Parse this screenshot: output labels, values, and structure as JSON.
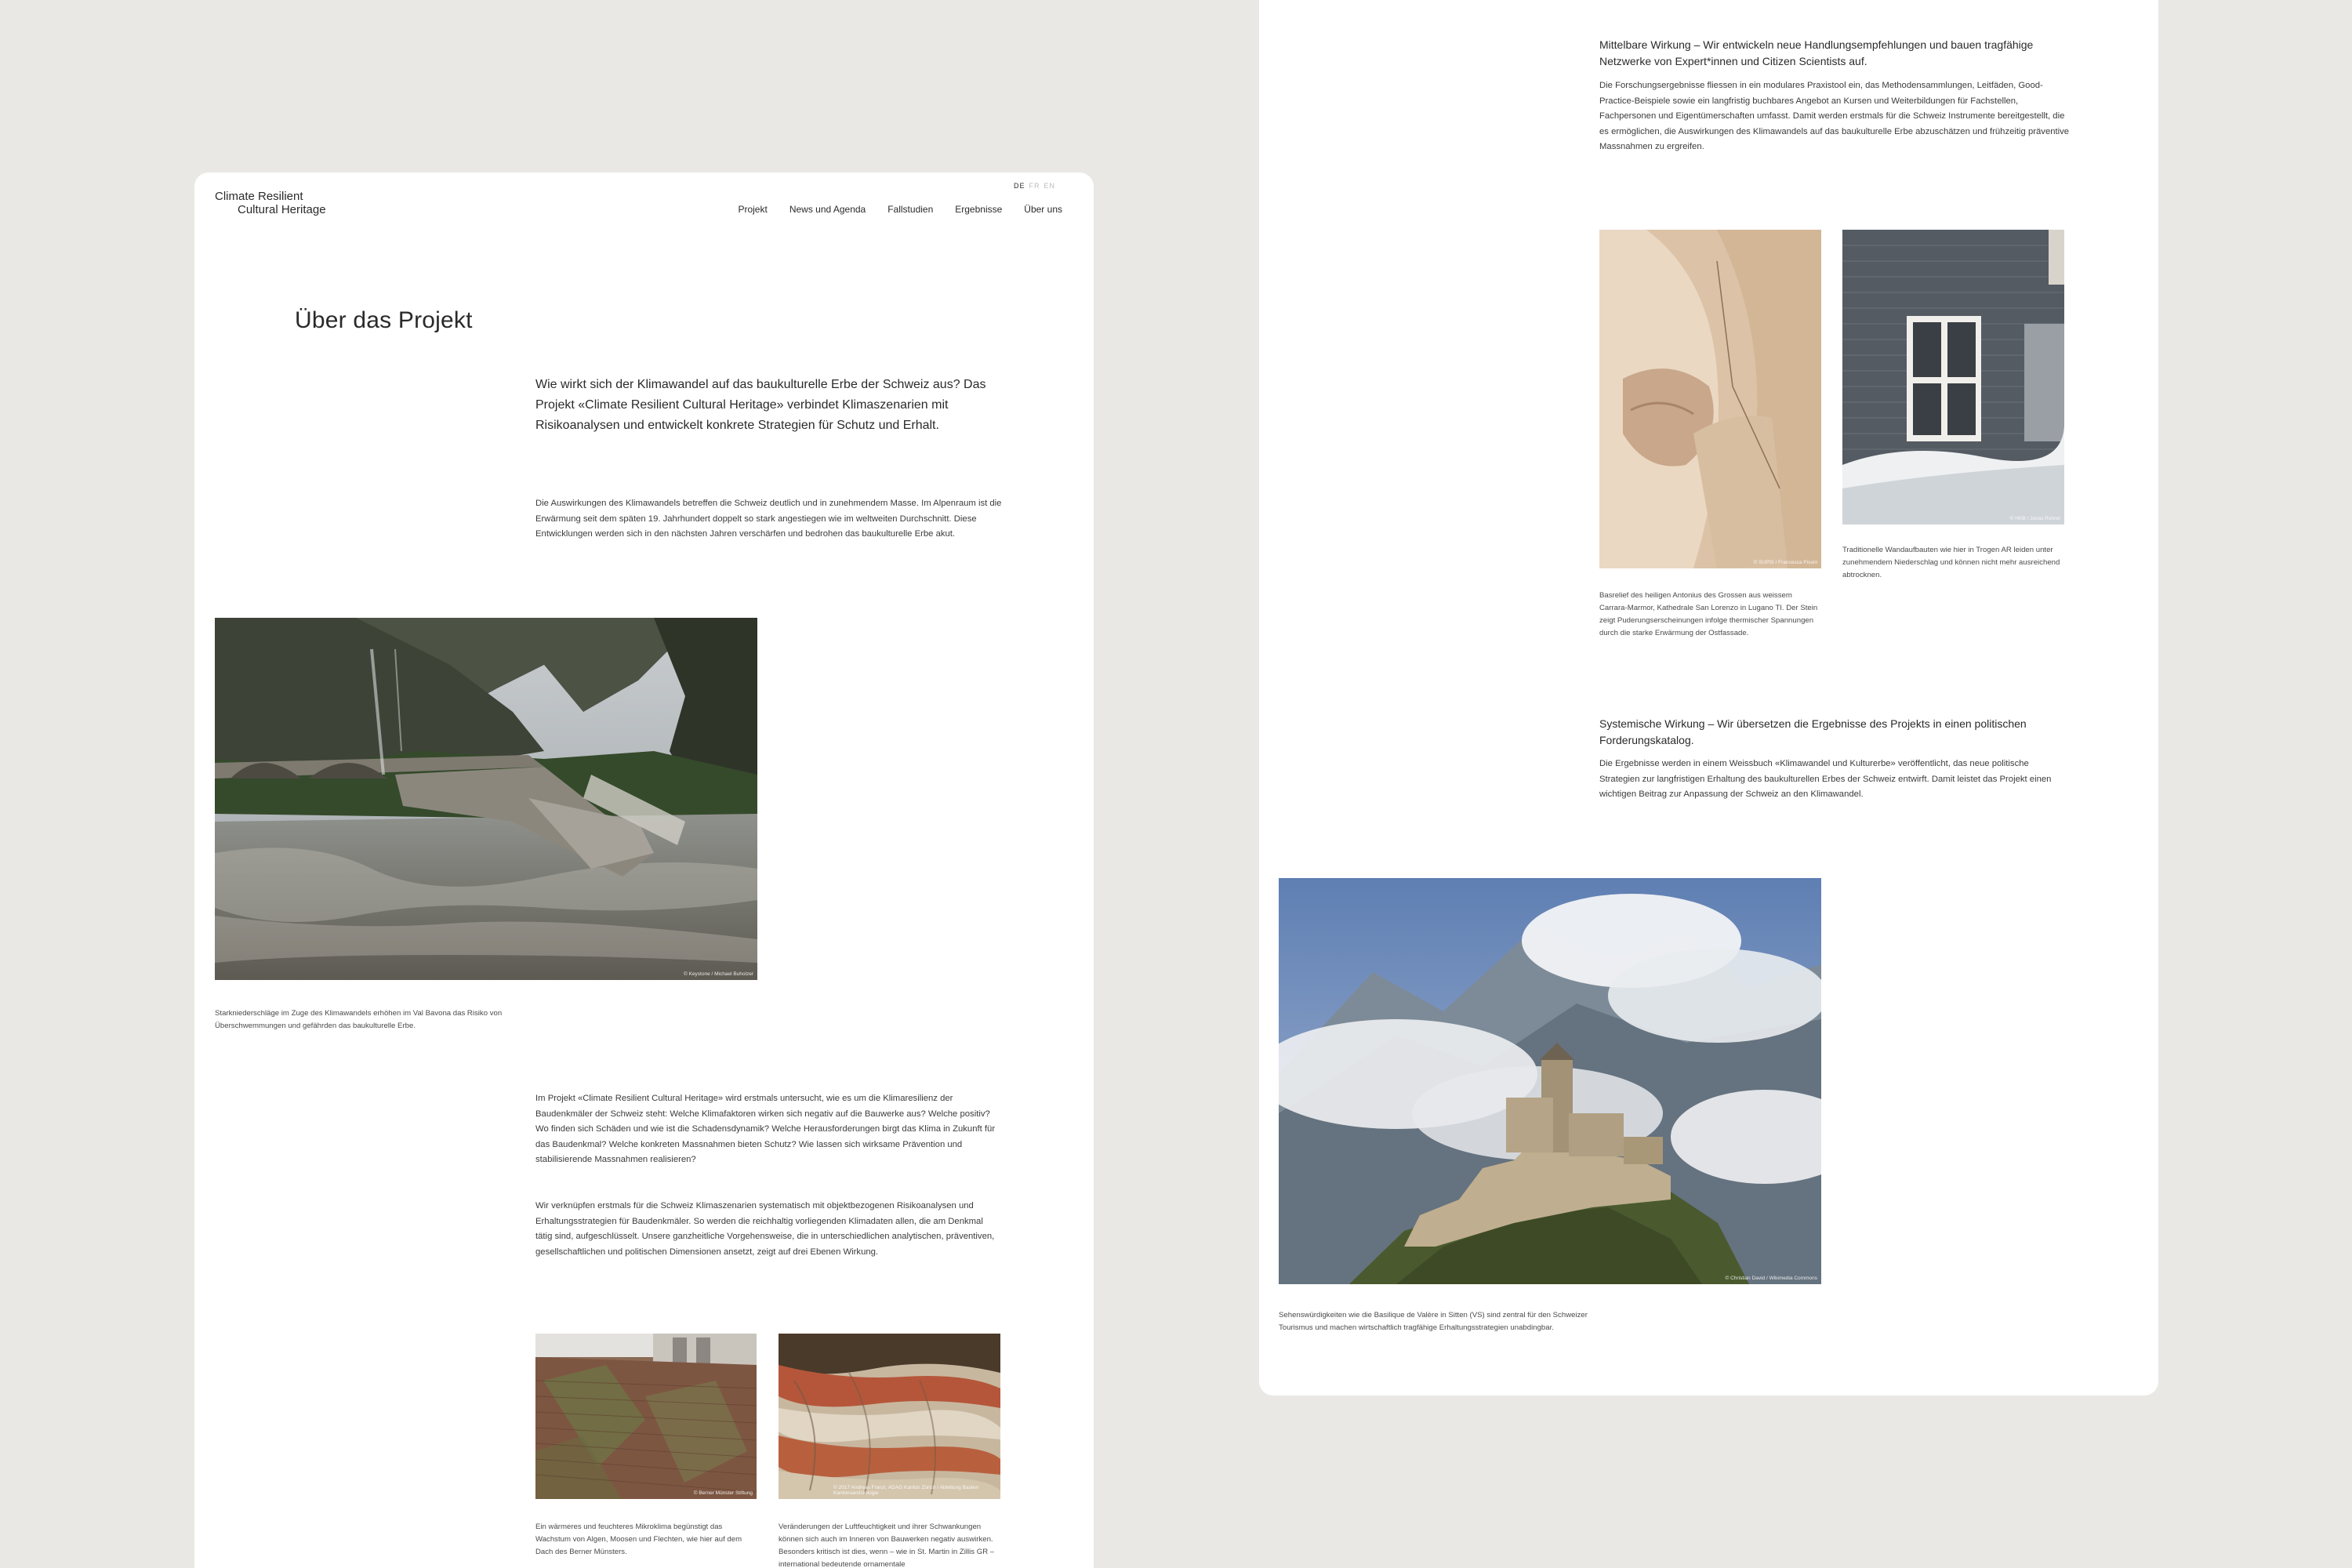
{
  "header": {
    "logo_line1": "Climate Resilient",
    "logo_line2": "Cultural Heritage",
    "lang": [
      "DE",
      "FR",
      "EN"
    ],
    "nav": [
      "Projekt",
      "News und Agenda",
      "Fallstudien",
      "Ergebnisse",
      "Über uns"
    ]
  },
  "page": {
    "title": "Über das Projekt",
    "lead": "Wie wirkt sich der Klimawandel auf das baukulturelle Erbe der Schweiz aus? Das Projekt «Climate Resilient Cultural Heritage» verbindet Klimaszenarien mit Risikoanalysen und entwickelt konkrete Strategien für Schutz und Erhalt.",
    "intro": "Die Auswirkungen des Klimawandels betreffen die Schweiz deutlich und in zunehmendem Masse. Im Alpenraum ist die Erwärmung seit dem späten 19. Jahrhundert doppelt so stark angestiegen wie im weltweiten Durchschnitt. Diese Entwicklungen werden sich in den nächsten Jahren verschärfen und bedrohen das baukulturelle Erbe akut.",
    "bridge_credit": "© Keystone / Michael Buholzer",
    "bridge_caption": "Starkniederschläge im Zuge des Klimawandels erhöhen im Val Bavona das Risiko von Überschwemmungen und gefährden das baukulturelle Erbe.",
    "para1": "Im Projekt «Climate Resilient Cultural Heritage» wird erstmals untersucht, wie es um die Klimaresilienz der Baudenkmäler der Schweiz steht: Welche Klimafaktoren wirken sich negativ auf die Bauwerke aus? Welche positiv? Wo finden sich Schäden und wie ist die Schadensdynamik? Welche Herausforderungen birgt das Klima in Zukunft für das Baudenkmal? Welche konkreten Massnahmen bieten Schutz? Wie lassen sich wirksame Prävention und stabilisierende Massnahmen realisieren?",
    "para2": "Wir verknüpfen erstmals für die Schweiz Klimaszenarien systematisch mit objektbezogenen Risikoanalysen und Erhaltungsstrategien für Baudenkmäler. So werden die reichhaltig vorliegenden Klimadaten allen, die am Denkmal tätig sind, aufgeschlüsselt. Unsere ganzheitliche Vorgehensweise, die in unterschiedlichen analytischen, präventiven, gesellschaftlichen und politischen Dimensionen ansetzt, zeigt auf drei Ebenen Wirkung.",
    "roof_credit": "© Berner Münster Stiftung",
    "roof_caption": "Ein wärmeres und feuchteres Mikroklima begünstigt das Wachstum von Algen, Moosen und Flechten, wie hier auf dem Dach des Berner Münsters.",
    "wood_credit": "© 2017 Andreas Franzi, ADAG Kanton Zürich / Abteilung Bauten Kantonsarchäologie",
    "wood_caption": "Veränderungen der Luftfeuchtigkeit und ihrer Schwankungen können sich auch im Inneren von Bauwerken negativ auswirken. Besonders kritisch ist dies, wenn – wie in St. Martin in Zillis GR – international bedeutende ornamentale"
  },
  "right": {
    "sub1": "Mittelbare Wirkung – Wir entwickeln neue Handlungsempfehlungen und bauen tragfähige Netzwerke von Expert*innen und Citizen Scientists auf.",
    "body1": "Die Forschungsergebnisse fliessen in ein modulares Praxistool ein, das Methodensammlungen, Leitfäden, Good-Practice-Beispiele sowie ein langfristig buchbares Angebot an Kursen und Weiterbildungen für Fachstellen, Fachpersonen und Eigentümerschaften umfasst. Damit werden erstmals für die Schweiz Instrumente bereitgestellt, die es ermöglichen, die Auswirkungen des Klimawandels auf das baukulturelle Erbe abzuschätzen und frühzeitig präventive Massnahmen zu ergreifen.",
    "statue_credit": "© SUPSI / Francesca Pisoni",
    "statue_caption": "Basrelief des heiligen Antonius des Grossen aus weissem Carrara-Marmor, Kathedrale San Lorenzo in Lugano TI. Der Stein zeigt Puderungserscheinungen infolge thermischer Spannungen durch die starke Erwärmung der Ostfassade.",
    "facade_credit": "© HKB / Jonas Rohrer",
    "facade_caption": "Traditionelle Wandaufbauten wie hier in Trogen AR leiden unter zunehmendem Niederschlag und können nicht mehr ausreichend abtrocknen.",
    "sub2": "Systemische Wirkung – Wir übersetzen die Ergebnisse des Projekts in einen politischen Forderungskatalog.",
    "body2": "Die Ergebnisse werden in einem Weissbuch «Klimawandel und Kulturerbe» veröffentlicht, das neue politische Strategien zur langfristigen Erhaltung des baukulturellen Erbes der Schweiz entwirft. Damit leistet das Projekt einen wichtigen Beitrag zur Anpassung der Schweiz an den Klimawandel.",
    "castle_credit": "© Christian David / Wikimedia Commons",
    "castle_caption": "Sehenswürdigkeiten wie die Basilique de Valère in Sitten (VS) sind zentral für den Schweizer Tourismus und machen wirtschaftlich tragfähige Erhaltungsstrategien unabdingbar."
  }
}
